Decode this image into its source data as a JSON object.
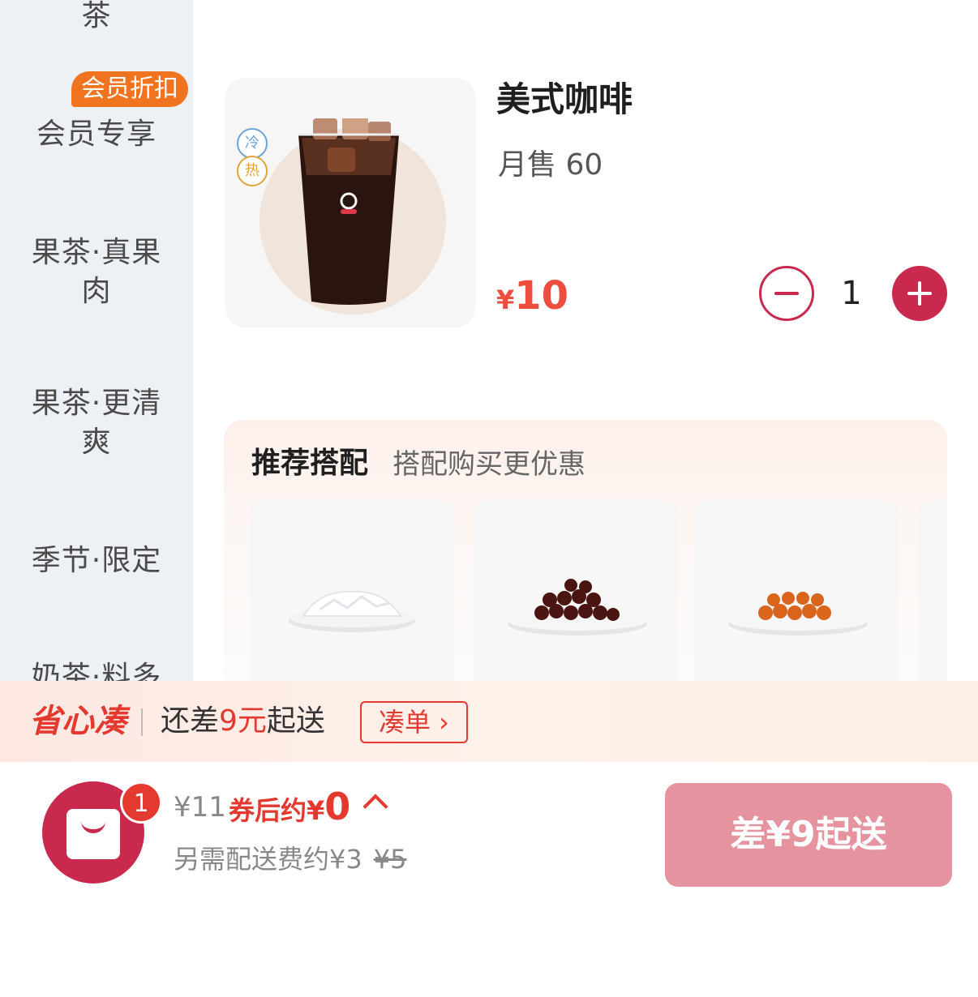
{
  "sidebar": {
    "badge": "会员折扣",
    "items": [
      {
        "line1": "茶",
        "line2": ""
      },
      {
        "line1": "会员专享",
        "line2": ""
      },
      {
        "line1": "果茶·真果",
        "line2": "肉"
      },
      {
        "line1": "果茶·更清",
        "line2": "爽"
      },
      {
        "line1": "季节·限定",
        "line2": ""
      },
      {
        "line1": "奶茶·料多",
        "line2": ""
      }
    ]
  },
  "product": {
    "name": "美式咖啡",
    "sales": "月售 60",
    "price_currency": "¥",
    "price_value": "10",
    "temp_cold": "冷",
    "temp_hot": "热",
    "quantity": "1"
  },
  "recommend": {
    "title": "推荐搭配",
    "subtitle": "搭配购买更优惠",
    "items": [
      {
        "icon": "coconut-jelly-plate-image"
      },
      {
        "icon": "brown-pearls-plate-image"
      },
      {
        "icon": "orange-boba-plate-image"
      }
    ]
  },
  "promo": {
    "logo": "省心凑",
    "text_before": "还差",
    "text_highlight": "9元",
    "text_after": "起送",
    "button": "凑单 ›"
  },
  "cart": {
    "badge_count": "1",
    "total": "¥11",
    "after_label": "券后约",
    "after_currency": "¥",
    "after_amount": "0",
    "fee_text": "另需配送费约¥3",
    "fee_original": "¥5",
    "checkout_label": "差¥9起送"
  },
  "colors": {
    "brand": "#c8294d",
    "accent_red": "#e4392f",
    "badge_orange": "#f0731f",
    "checkout_disabled": "#e5939f"
  }
}
